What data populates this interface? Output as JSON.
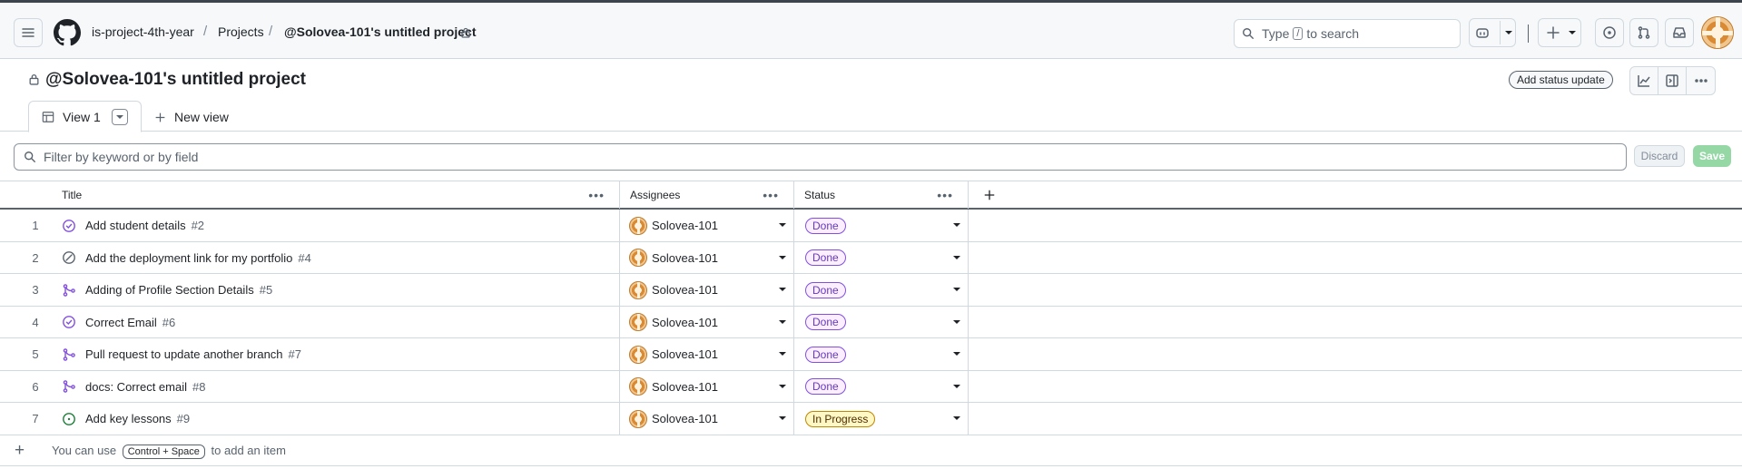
{
  "header": {
    "org": "is-project-4th-year",
    "projects": "Projects",
    "project_crumb": "@Solovea-101's untitled project",
    "search_prefix": "Type",
    "search_key": "/",
    "search_suffix": "to search"
  },
  "project": {
    "title": "@Solovea-101's untitled project",
    "add_status_update": "Add status update"
  },
  "tabs": {
    "active_label": "View 1",
    "new_view": "New view"
  },
  "filter": {
    "placeholder": "Filter by keyword or by field",
    "discard": "Discard",
    "save": "Save"
  },
  "columns": {
    "title": "Title",
    "assignees": "Assignees",
    "status": "Status"
  },
  "rows": [
    {
      "num": "1",
      "kind": "issue-closed",
      "title": "Add student details",
      "ref": "#2",
      "assignee": "Solovea-101",
      "status": "Done"
    },
    {
      "num": "2",
      "kind": "issue-skipped",
      "title": "Add the deployment link for my portfolio",
      "ref": "#4",
      "assignee": "Solovea-101",
      "status": "Done"
    },
    {
      "num": "3",
      "kind": "pr-merged",
      "title": "Adding of Profile Section Details",
      "ref": "#5",
      "assignee": "Solovea-101",
      "status": "Done"
    },
    {
      "num": "4",
      "kind": "issue-closed",
      "title": "Correct Email",
      "ref": "#6",
      "assignee": "Solovea-101",
      "status": "Done"
    },
    {
      "num": "5",
      "kind": "pr-merged",
      "title": "Pull request to update another branch",
      "ref": "#7",
      "assignee": "Solovea-101",
      "status": "Done"
    },
    {
      "num": "6",
      "kind": "pr-merged",
      "title": "docs: Correct email",
      "ref": "#8",
      "assignee": "Solovea-101",
      "status": "Done"
    },
    {
      "num": "7",
      "kind": "issue-open",
      "title": "Add key lessons",
      "ref": "#9",
      "assignee": "Solovea-101",
      "status": "In Progress"
    }
  ],
  "footer": {
    "prefix": "You can use",
    "shortcut": "Control + Space",
    "suffix": "to add an item"
  },
  "colors": {
    "done": "#8250df",
    "in_progress": "#bf8700",
    "open": "#1a7f37",
    "save_disabled": "#95d8a6"
  }
}
